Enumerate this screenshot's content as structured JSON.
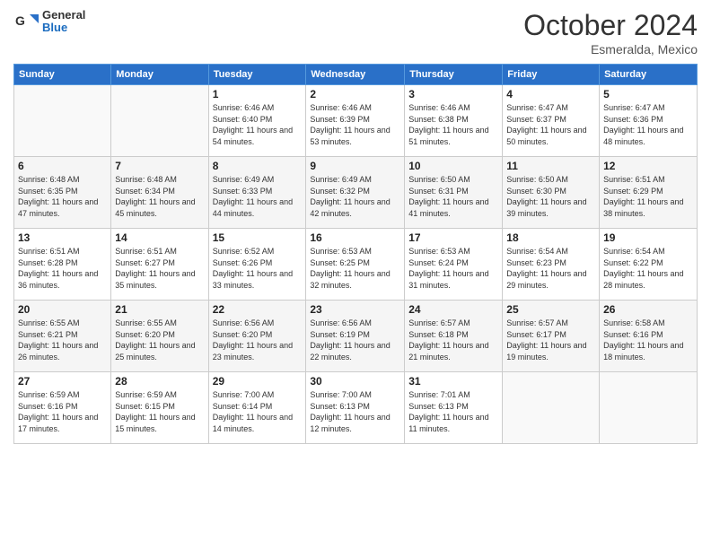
{
  "header": {
    "logo": {
      "general": "General",
      "blue": "Blue"
    },
    "title": "October 2024",
    "subtitle": "Esmeralda, Mexico"
  },
  "weekdays": [
    "Sunday",
    "Monday",
    "Tuesday",
    "Wednesday",
    "Thursday",
    "Friday",
    "Saturday"
  ],
  "weeks": [
    [
      {
        "day": "",
        "info": ""
      },
      {
        "day": "",
        "info": ""
      },
      {
        "day": "1",
        "info": "Sunrise: 6:46 AM\nSunset: 6:40 PM\nDaylight: 11 hours and 54 minutes."
      },
      {
        "day": "2",
        "info": "Sunrise: 6:46 AM\nSunset: 6:39 PM\nDaylight: 11 hours and 53 minutes."
      },
      {
        "day": "3",
        "info": "Sunrise: 6:46 AM\nSunset: 6:38 PM\nDaylight: 11 hours and 51 minutes."
      },
      {
        "day": "4",
        "info": "Sunrise: 6:47 AM\nSunset: 6:37 PM\nDaylight: 11 hours and 50 minutes."
      },
      {
        "day": "5",
        "info": "Sunrise: 6:47 AM\nSunset: 6:36 PM\nDaylight: 11 hours and 48 minutes."
      }
    ],
    [
      {
        "day": "6",
        "info": "Sunrise: 6:48 AM\nSunset: 6:35 PM\nDaylight: 11 hours and 47 minutes."
      },
      {
        "day": "7",
        "info": "Sunrise: 6:48 AM\nSunset: 6:34 PM\nDaylight: 11 hours and 45 minutes."
      },
      {
        "day": "8",
        "info": "Sunrise: 6:49 AM\nSunset: 6:33 PM\nDaylight: 11 hours and 44 minutes."
      },
      {
        "day": "9",
        "info": "Sunrise: 6:49 AM\nSunset: 6:32 PM\nDaylight: 11 hours and 42 minutes."
      },
      {
        "day": "10",
        "info": "Sunrise: 6:50 AM\nSunset: 6:31 PM\nDaylight: 11 hours and 41 minutes."
      },
      {
        "day": "11",
        "info": "Sunrise: 6:50 AM\nSunset: 6:30 PM\nDaylight: 11 hours and 39 minutes."
      },
      {
        "day": "12",
        "info": "Sunrise: 6:51 AM\nSunset: 6:29 PM\nDaylight: 11 hours and 38 minutes."
      }
    ],
    [
      {
        "day": "13",
        "info": "Sunrise: 6:51 AM\nSunset: 6:28 PM\nDaylight: 11 hours and 36 minutes."
      },
      {
        "day": "14",
        "info": "Sunrise: 6:51 AM\nSunset: 6:27 PM\nDaylight: 11 hours and 35 minutes."
      },
      {
        "day": "15",
        "info": "Sunrise: 6:52 AM\nSunset: 6:26 PM\nDaylight: 11 hours and 33 minutes."
      },
      {
        "day": "16",
        "info": "Sunrise: 6:53 AM\nSunset: 6:25 PM\nDaylight: 11 hours and 32 minutes."
      },
      {
        "day": "17",
        "info": "Sunrise: 6:53 AM\nSunset: 6:24 PM\nDaylight: 11 hours and 31 minutes."
      },
      {
        "day": "18",
        "info": "Sunrise: 6:54 AM\nSunset: 6:23 PM\nDaylight: 11 hours and 29 minutes."
      },
      {
        "day": "19",
        "info": "Sunrise: 6:54 AM\nSunset: 6:22 PM\nDaylight: 11 hours and 28 minutes."
      }
    ],
    [
      {
        "day": "20",
        "info": "Sunrise: 6:55 AM\nSunset: 6:21 PM\nDaylight: 11 hours and 26 minutes."
      },
      {
        "day": "21",
        "info": "Sunrise: 6:55 AM\nSunset: 6:20 PM\nDaylight: 11 hours and 25 minutes."
      },
      {
        "day": "22",
        "info": "Sunrise: 6:56 AM\nSunset: 6:20 PM\nDaylight: 11 hours and 23 minutes."
      },
      {
        "day": "23",
        "info": "Sunrise: 6:56 AM\nSunset: 6:19 PM\nDaylight: 11 hours and 22 minutes."
      },
      {
        "day": "24",
        "info": "Sunrise: 6:57 AM\nSunset: 6:18 PM\nDaylight: 11 hours and 21 minutes."
      },
      {
        "day": "25",
        "info": "Sunrise: 6:57 AM\nSunset: 6:17 PM\nDaylight: 11 hours and 19 minutes."
      },
      {
        "day": "26",
        "info": "Sunrise: 6:58 AM\nSunset: 6:16 PM\nDaylight: 11 hours and 18 minutes."
      }
    ],
    [
      {
        "day": "27",
        "info": "Sunrise: 6:59 AM\nSunset: 6:16 PM\nDaylight: 11 hours and 17 minutes."
      },
      {
        "day": "28",
        "info": "Sunrise: 6:59 AM\nSunset: 6:15 PM\nDaylight: 11 hours and 15 minutes."
      },
      {
        "day": "29",
        "info": "Sunrise: 7:00 AM\nSunset: 6:14 PM\nDaylight: 11 hours and 14 minutes."
      },
      {
        "day": "30",
        "info": "Sunrise: 7:00 AM\nSunset: 6:13 PM\nDaylight: 11 hours and 12 minutes."
      },
      {
        "day": "31",
        "info": "Sunrise: 7:01 AM\nSunset: 6:13 PM\nDaylight: 11 hours and 11 minutes."
      },
      {
        "day": "",
        "info": ""
      },
      {
        "day": "",
        "info": ""
      }
    ]
  ]
}
